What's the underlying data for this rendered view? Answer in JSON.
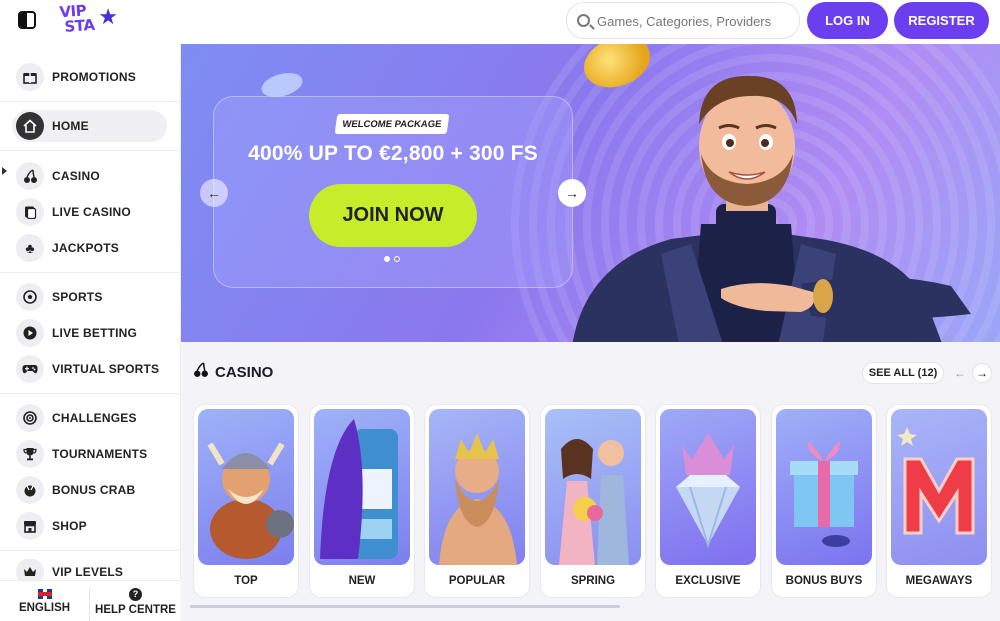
{
  "header": {
    "logo_text_line1": "VIP",
    "logo_text_line2": "STA",
    "search_placeholder": "Games, Categories, Providers",
    "login_label": "LOG IN",
    "register_label": "REGISTER"
  },
  "sidebar": {
    "items": [
      {
        "label": "PROMOTIONS",
        "icon": "gift-icon"
      },
      {
        "label": "HOME",
        "icon": "home-icon",
        "active": true
      },
      {
        "label": "CASINO",
        "icon": "cherry-icon"
      },
      {
        "label": "LIVE CASINO",
        "icon": "cards-icon"
      },
      {
        "label": "JACKPOTS",
        "icon": "clover-icon"
      },
      {
        "label": "SPORTS",
        "icon": "soccer-ball-icon"
      },
      {
        "label": "LIVE BETTING",
        "icon": "play-icon"
      },
      {
        "label": "VIRTUAL SPORTS",
        "icon": "gamepad-icon"
      },
      {
        "label": "CHALLENGES",
        "icon": "target-icon"
      },
      {
        "label": "TOURNAMENTS",
        "icon": "trophy-icon"
      },
      {
        "label": "BONUS CRAB",
        "icon": "claw-icon"
      },
      {
        "label": "SHOP",
        "icon": "shop-icon"
      },
      {
        "label": "VIP LEVELS",
        "icon": "crown-icon"
      }
    ],
    "footer": {
      "language_label": "ENGLISH",
      "help_label": "HELP CENTRE"
    }
  },
  "hero": {
    "tag": "WELCOME PACKAGE",
    "title": "400% UP TO €2,800 + 300 FS",
    "cta_label": "JOIN NOW",
    "slides_total": 2,
    "slide_active": 1
  },
  "casino": {
    "title": "CASINO",
    "see_all_label": "SEE ALL (12)",
    "categories": [
      {
        "label": "TOP"
      },
      {
        "label": "NEW"
      },
      {
        "label": "POPULAR"
      },
      {
        "label": "SPRING"
      },
      {
        "label": "EXCLUSIVE"
      },
      {
        "label": "BONUS BUYS"
      },
      {
        "label": "MEGAWAYS"
      }
    ]
  },
  "colors": {
    "accent": "#6b3ff0",
    "cta": "#c6ec2a"
  }
}
